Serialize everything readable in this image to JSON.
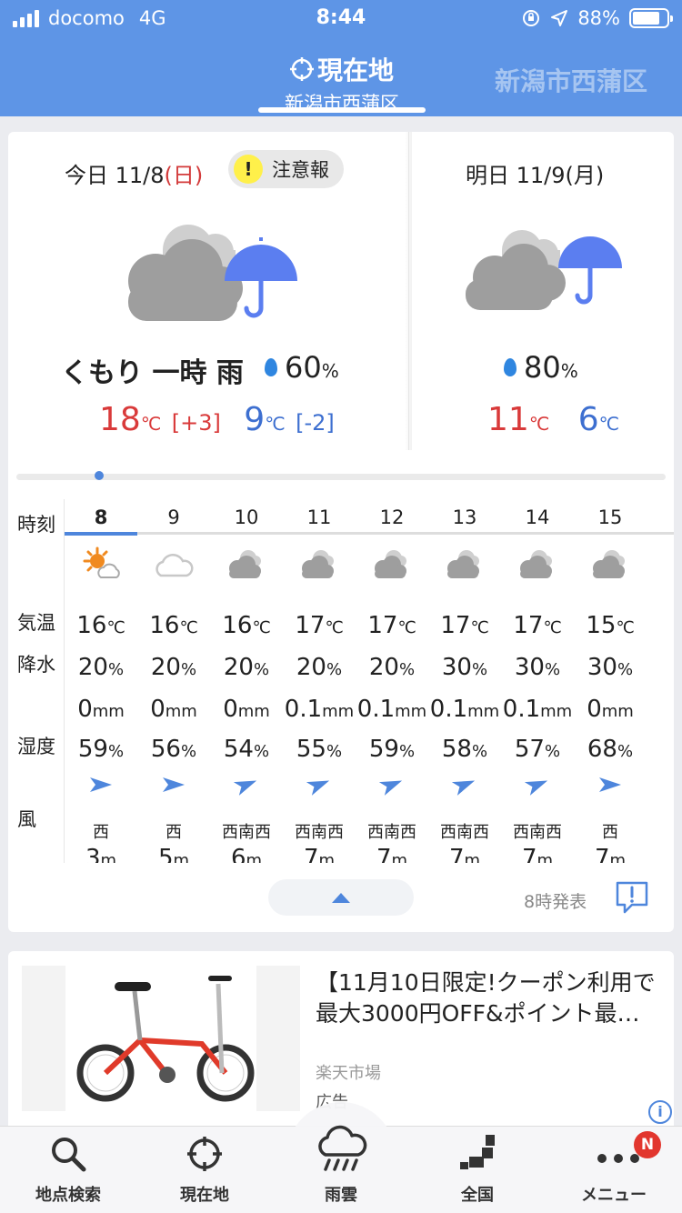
{
  "status_bar": {
    "carrier": "docomo",
    "network": "4G",
    "time": "8:44",
    "battery": "88%"
  },
  "header": {
    "current_tab_title": "現在地",
    "current_tab_subtitle": "新潟市西蒲区",
    "next_tab": "新潟市西蒲区"
  },
  "today": {
    "label": "今日",
    "date": "11/8",
    "dow": "(日)",
    "alert_icon": "!",
    "alert_label": "注意報",
    "weather": "くもり 一時 雨",
    "pop_value": "60",
    "pop_unit": "%",
    "high": "18",
    "high_unit": "℃",
    "high_diff": "[+3]",
    "low": "9",
    "low_unit": "℃",
    "low_diff": "[-2]",
    "icon": "cloudy-then-rain-icon"
  },
  "tomorrow": {
    "label": "明日",
    "date": "11/9",
    "dow": "(月)",
    "pop_value": "80",
    "pop_unit": "%",
    "high": "11",
    "high_unit": "℃",
    "low": "6",
    "low_unit": "℃",
    "icon": "cloudy-then-rain-icon"
  },
  "hourly": {
    "row_labels": {
      "time": "時刻",
      "temp": "気温",
      "precip": "降水",
      "humidity": "湿度",
      "wind": "風"
    },
    "hours": [
      {
        "hour": "8",
        "icon": "sun-cloud-icon",
        "temp": "16",
        "temp_unit": "℃",
        "pop": "20",
        "pop_unit": "%",
        "amount": "0",
        "amount_unit": "mm",
        "humidity": "59",
        "hum_unit": "%",
        "dir": "西",
        "speed": "3",
        "speed_unit": "m"
      },
      {
        "hour": "9",
        "icon": "cloud-outline-icon",
        "temp": "16",
        "temp_unit": "℃",
        "pop": "20",
        "pop_unit": "%",
        "amount": "0",
        "amount_unit": "mm",
        "humidity": "56",
        "hum_unit": "%",
        "dir": "西",
        "speed": "5",
        "speed_unit": "m"
      },
      {
        "hour": "10",
        "icon": "cloud-icon",
        "temp": "16",
        "temp_unit": "℃",
        "pop": "20",
        "pop_unit": "%",
        "amount": "0",
        "amount_unit": "mm",
        "humidity": "54",
        "hum_unit": "%",
        "dir": "西南西",
        "speed": "6",
        "speed_unit": "m"
      },
      {
        "hour": "11",
        "icon": "cloud-icon",
        "temp": "17",
        "temp_unit": "℃",
        "pop": "20",
        "pop_unit": "%",
        "amount": "0.1",
        "amount_unit": "mm",
        "humidity": "55",
        "hum_unit": "%",
        "dir": "西南西",
        "speed": "7",
        "speed_unit": "m"
      },
      {
        "hour": "12",
        "icon": "cloud-icon",
        "temp": "17",
        "temp_unit": "℃",
        "pop": "20",
        "pop_unit": "%",
        "amount": "0.1",
        "amount_unit": "mm",
        "humidity": "59",
        "hum_unit": "%",
        "dir": "西南西",
        "speed": "7",
        "speed_unit": "m"
      },
      {
        "hour": "13",
        "icon": "cloud-icon",
        "temp": "17",
        "temp_unit": "℃",
        "pop": "30",
        "pop_unit": "%",
        "amount": "0.1",
        "amount_unit": "mm",
        "humidity": "58",
        "hum_unit": "%",
        "dir": "西南西",
        "speed": "7",
        "speed_unit": "m"
      },
      {
        "hour": "14",
        "icon": "cloud-icon",
        "temp": "17",
        "temp_unit": "℃",
        "pop": "30",
        "pop_unit": "%",
        "amount": "0.1",
        "amount_unit": "mm",
        "humidity": "57",
        "hum_unit": "%",
        "dir": "西南西",
        "speed": "7",
        "speed_unit": "m"
      },
      {
        "hour": "15",
        "icon": "cloud-icon",
        "temp": "15",
        "temp_unit": "℃",
        "pop": "30",
        "pop_unit": "%",
        "amount": "0",
        "amount_unit": "mm",
        "humidity": "68",
        "hum_unit": "%",
        "dir": "西",
        "speed": "7",
        "speed_unit": "m"
      }
    ],
    "issued": "8時発表"
  },
  "ad": {
    "title": "【11月10日限定!クーポン利用で最大3000円OFF&ポイント最…",
    "store": "楽天市場",
    "label": "広告",
    "info_icon": "i"
  },
  "bottom_nav": {
    "items": [
      {
        "label": "地点検索",
        "icon": "search-icon"
      },
      {
        "label": "現在地",
        "icon": "crosshair-icon"
      },
      {
        "label": "雨雲",
        "icon": "rain-cloud-icon"
      },
      {
        "label": "全国",
        "icon": "map-japan-icon"
      },
      {
        "label": "メニュー",
        "icon": "more-icon"
      }
    ],
    "badge": "N"
  },
  "colors": {
    "header": "#5e95e6",
    "hi_temp": "#d93a3a",
    "lo_temp": "#3d6fd0",
    "umbrella": "#5b7ef0",
    "cloud": "#9e9e9e",
    "accent": "#4e86dc"
  }
}
